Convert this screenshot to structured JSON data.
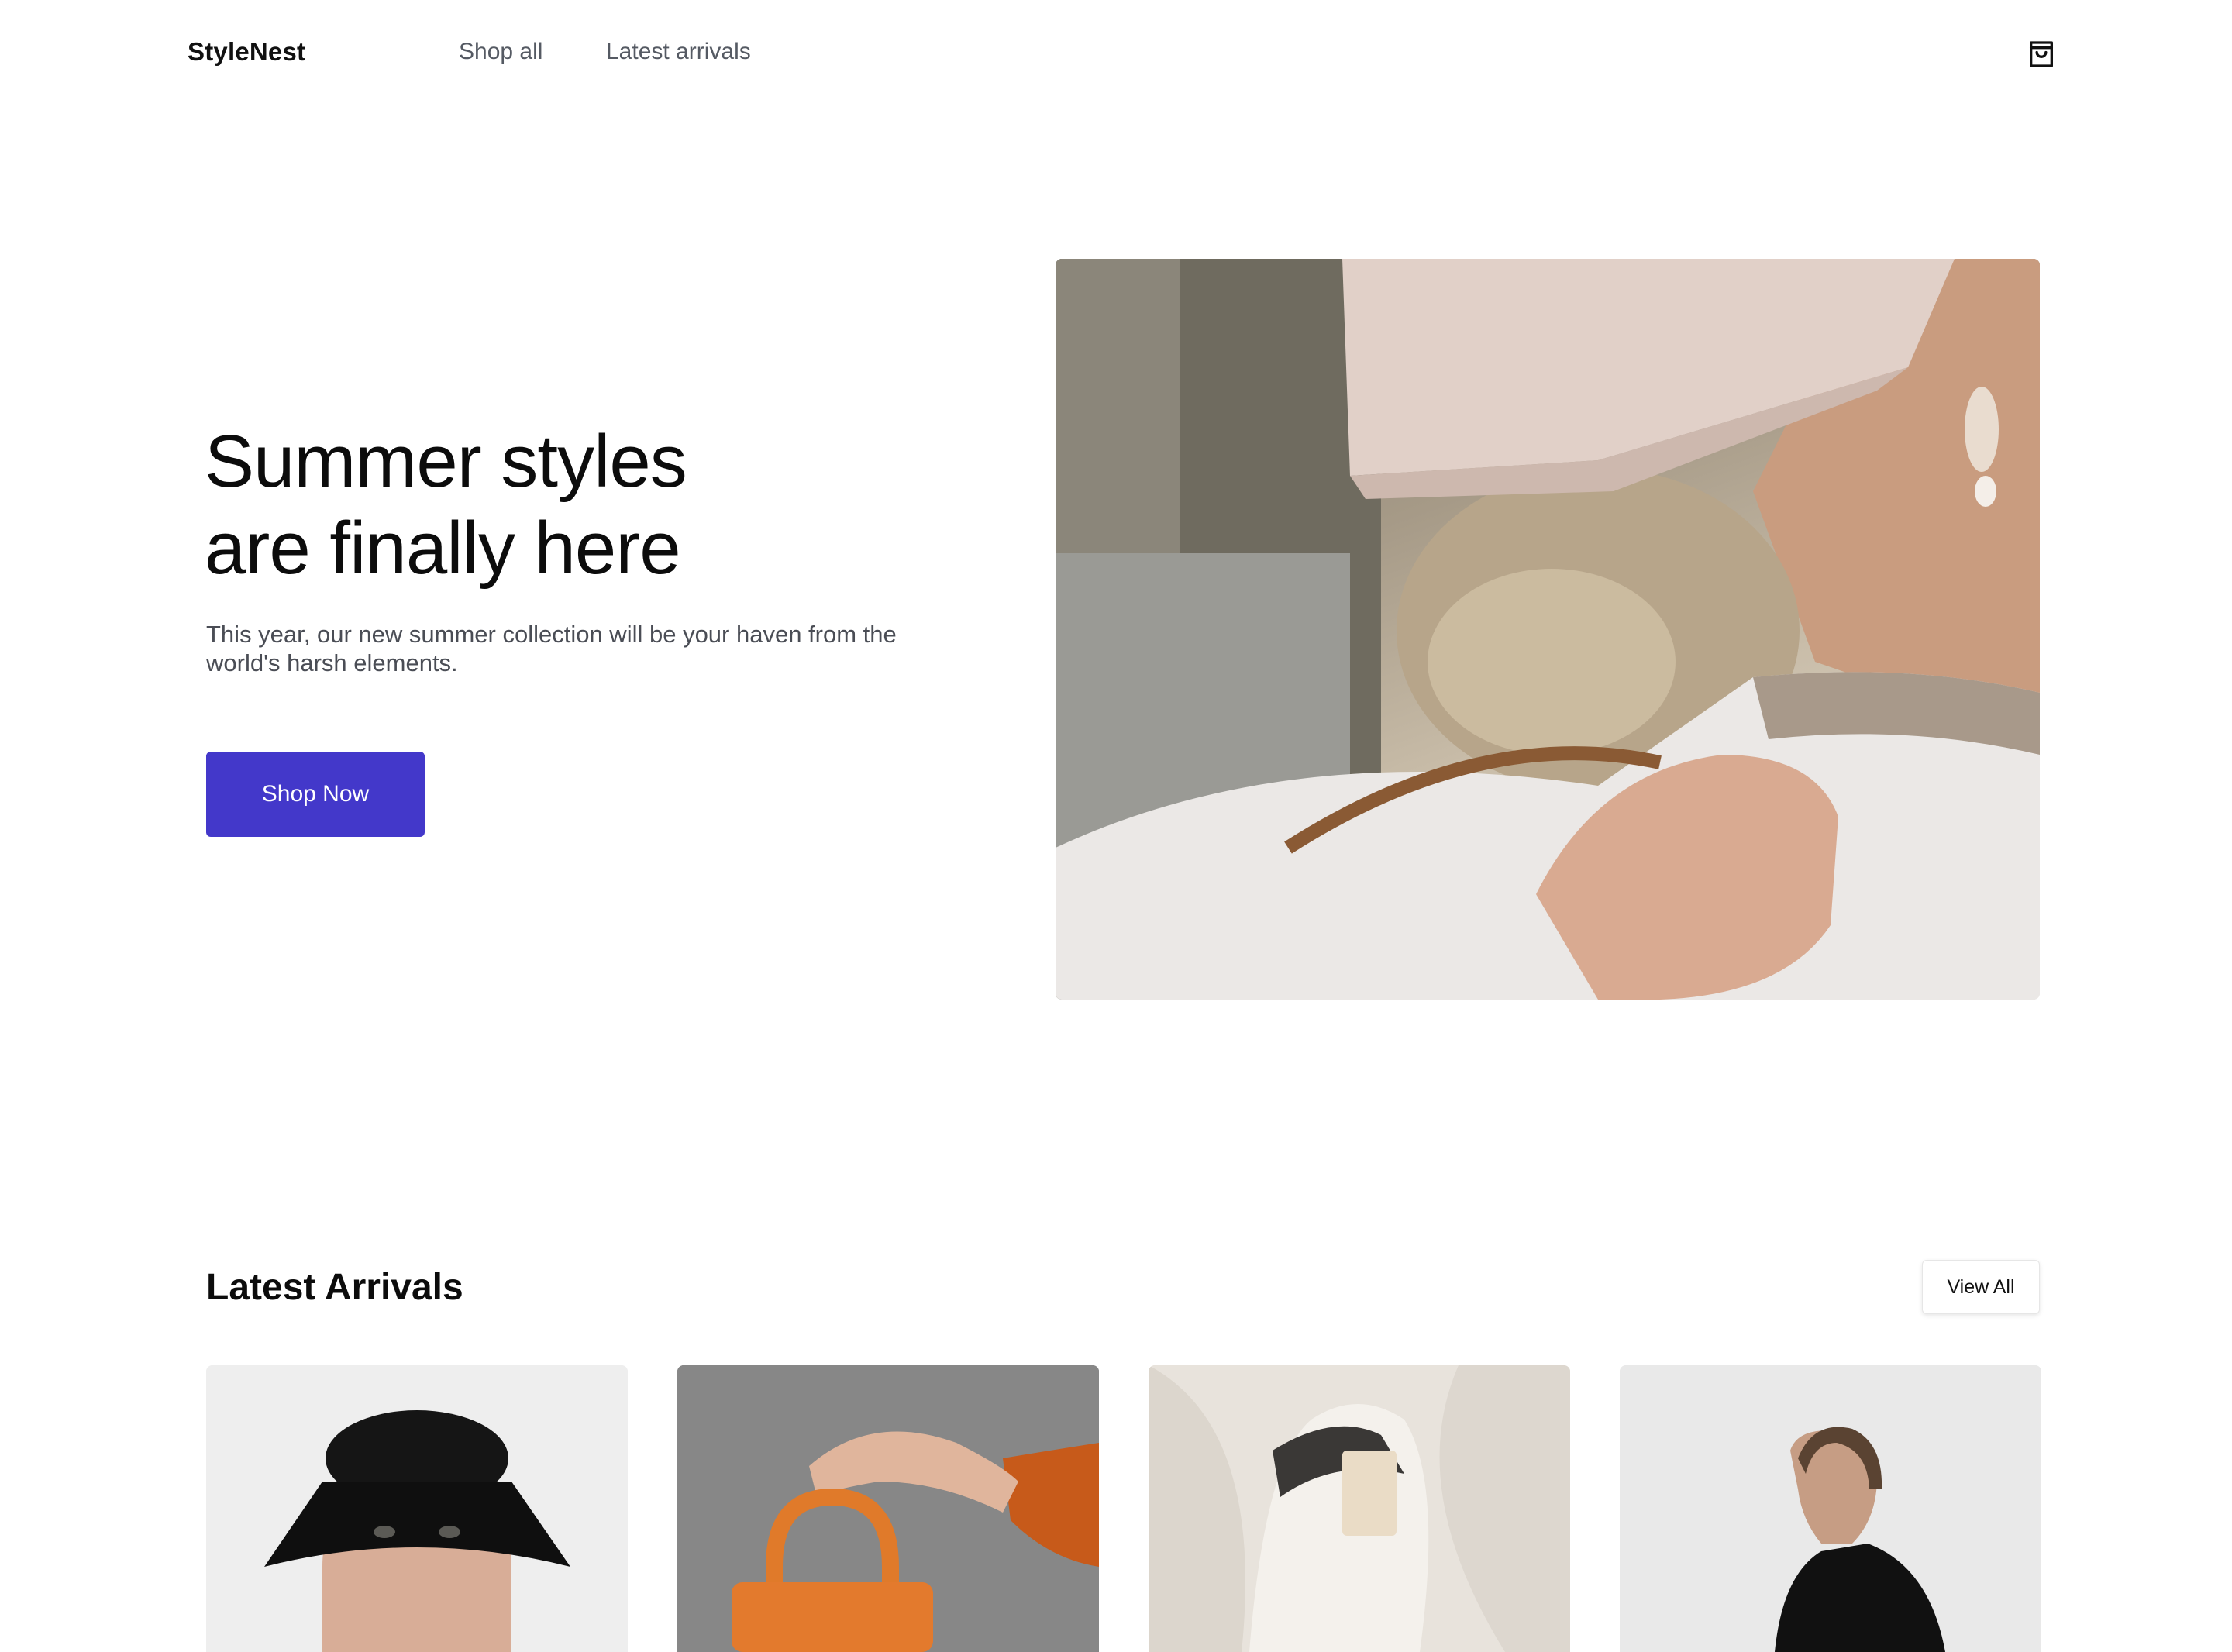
{
  "nav": {
    "brand": "StyleNest",
    "links": [
      "Shop all",
      "Latest arrivals"
    ],
    "cart_icon": "shopping-bag-icon"
  },
  "hero": {
    "title_lines": [
      "Summer styles",
      "are finally here"
    ],
    "subtitle": "This year, our new summer collection will be your haven from the world's harsh elements.",
    "cta_label": "Shop Now",
    "cta_color": "#4338ca",
    "image": "woman-in-beret-and-sweater-photo"
  },
  "arrivals": {
    "title": "Latest Arrivals",
    "view_all_label": "View All",
    "products": [
      {
        "image": "man-in-black-bucket-hat-photo"
      },
      {
        "image": "hand-holding-orange-handbag-photo"
      },
      {
        "image": "white-sneaker-photo"
      },
      {
        "image": "woman-in-black-hoodie-photo"
      }
    ]
  }
}
